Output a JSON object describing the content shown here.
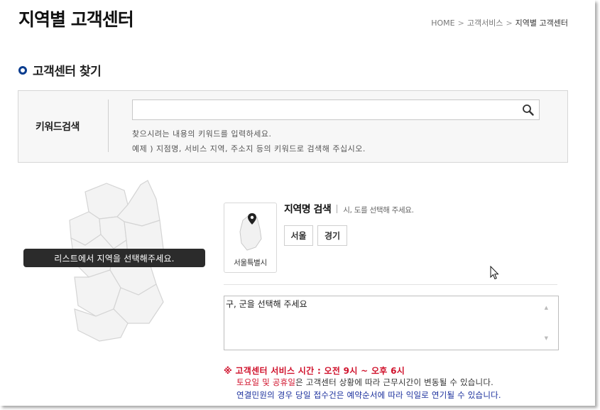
{
  "page": {
    "title": "지역별 고객센터",
    "breadcrumb": [
      "HOME",
      "고객서비스",
      "지역별 고객센터"
    ]
  },
  "section": {
    "title": "고객센터 찾기"
  },
  "search": {
    "label": "키워드검색",
    "value": "",
    "hint1": "찾으시려는 내용의 키워드를 입력하세요.",
    "hint2": "예제 ) 지점명, 서비스 지역, 주소지 등의 키워드로 검색해 주십시오.",
    "icon": "search-icon"
  },
  "map": {
    "tooltip": "리스트에서 지역을 선택해주세요."
  },
  "region": {
    "card_caption": "서울특별시",
    "title": "지역명 검색",
    "subtitle": "시, 도를 선택해 주세요.",
    "buttons": [
      "서울",
      "경기"
    ]
  },
  "district_list": {
    "placeholder": "구, 군을 선택해 주세요"
  },
  "notice": {
    "line1": "※ 고객센터 서비스 시간 : 오전 9시 ~ 오후 6시",
    "line2_red": "토요일 및 공휴일",
    "line2_rest": "은 고객센터 상황에 따라 근무시간이 변동될 수 있습니다.",
    "line3": "연결민원의 경우 당일 접수건은 예약순서에 따라 익일로 연기될 수 있습니다."
  },
  "colors": {
    "accent": "#0a3d8f",
    "notice_red": "#d0112b",
    "notice_blue": "#1a2f9c"
  }
}
